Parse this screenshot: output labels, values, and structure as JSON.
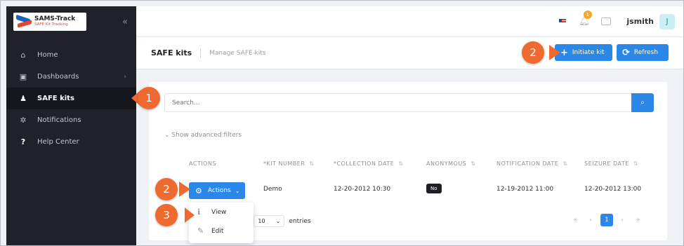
{
  "brand": {
    "title": "SAMS-Track",
    "subtitle": "SAFE Kit Tracking"
  },
  "sidebar": {
    "items": [
      {
        "label": "Home",
        "icon": "home-icon"
      },
      {
        "label": "Dashboards",
        "icon": "dashboard-icon"
      },
      {
        "label": "SAFE kits",
        "icon": "kit-icon"
      },
      {
        "label": "Notifications",
        "icon": "bell-icon"
      },
      {
        "label": "Help Center",
        "icon": "help-icon"
      }
    ]
  },
  "topbar": {
    "notification_count": "1",
    "username": "jsmith",
    "avatar_initial": "J"
  },
  "page": {
    "title": "SAFE kits",
    "subtitle": "Manage SAFE kits",
    "initiate_label": "Initiate kit",
    "refresh_label": "Refresh"
  },
  "search": {
    "placeholder": "Search..."
  },
  "filters": {
    "label": "Show advanced filters"
  },
  "table": {
    "headers": [
      "ACTIONS",
      "*KIT NUMBER",
      "*COLLECTION DATE",
      "ANONYMOUS",
      "NOTIFICATION DATE",
      "SEIZURE DATE"
    ],
    "row": {
      "actions_label": "Actions",
      "kit_number": "Demo",
      "collection_date": "12-20-2012 10:30",
      "anonymous": "No",
      "notification_date": "12-19-2012 11:00",
      "seizure_date": "12-20-2012 13:00"
    }
  },
  "actions_menu": {
    "view": "View",
    "edit": "Edit"
  },
  "entries": {
    "prefix": "w",
    "value": "10",
    "suffix": "entries"
  },
  "pagination": {
    "first": "«",
    "prev": "‹",
    "page": "1",
    "next": "›",
    "last": "»"
  },
  "markers": [
    "1",
    "2",
    "2",
    "3"
  ],
  "colors": {
    "accent": "#2b87e8",
    "callout": "#ef6a2e",
    "sidebar": "#1f2329"
  }
}
